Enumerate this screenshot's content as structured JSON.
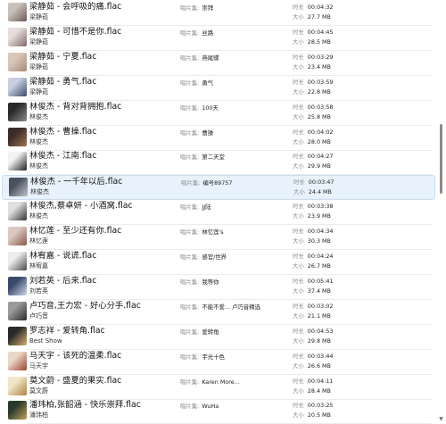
{
  "labels": {
    "album": "唱片集:",
    "duration": "时长",
    "size": "大小"
  },
  "tracks": [
    {
      "title": "梁静茹 - 会呼吸的痛.flac",
      "artist": "梁静茹",
      "album": "崇拜",
      "duration": "00:04:32",
      "size": "27.7 MB",
      "thumb_colors": [
        "#c9c1bb",
        "#6b5a55"
      ]
    },
    {
      "title": "梁静茹 - 可惜不是你.flac",
      "artist": "梁静茹",
      "album": "丝路",
      "duration": "00:04:45",
      "size": "28.5 MB",
      "thumb_colors": [
        "#e7dcdc",
        "#7d6a66"
      ]
    },
    {
      "title": "梁静茹 - 宁夏.flac",
      "artist": "梁静茹",
      "album": "燕尾蝶",
      "duration": "00:03:29",
      "size": "23.4 MB",
      "thumb_colors": [
        "#d8c7b8",
        "#a58b78"
      ]
    },
    {
      "title": "梁静茹 - 勇气.flac",
      "artist": "梁静茹",
      "album": "勇气",
      "duration": "00:03:59",
      "size": "22.8 MB",
      "thumb_colors": [
        "#c7cfe0",
        "#3b4a6b"
      ]
    },
    {
      "title": "林俊杰 - 背对背拥抱.flac",
      "artist": "林俊杰",
      "album": "100天",
      "duration": "00:03:58",
      "size": "25.8 MB",
      "thumb_colors": [
        "#2a2a2a",
        "#8c8c8c"
      ]
    },
    {
      "title": "林俊杰 - 曹操.flac",
      "artist": "林俊杰",
      "album": "曹操",
      "duration": "00:04:02",
      "size": "28.0 MB",
      "thumb_colors": [
        "#3a2c28",
        "#a07050"
      ]
    },
    {
      "title": "林俊杰 - 江南.flac",
      "artist": "林俊杰",
      "album": "第二天堂",
      "duration": "00:04:27",
      "size": "29.9 MB",
      "thumb_colors": [
        "#f2f2f2",
        "#1e1e1e"
      ]
    },
    {
      "title": "林俊杰 - 一千年以后.flac",
      "artist": "林俊杰",
      "album": "编号89757",
      "duration": "00:03:47",
      "size": "24.4 MB",
      "thumb_colors": [
        "#4a5060",
        "#c0c4cc"
      ]
    },
    {
      "title": "林俊杰,蔡卓妍 - 小酒窝.flac",
      "artist": "林俊杰",
      "album": "JJ陆",
      "duration": "00:03:38",
      "size": "23.9 MB",
      "thumb_colors": [
        "#e0e0e0",
        "#333333"
      ]
    },
    {
      "title": "林忆莲 - 至少还有你.flac",
      "artist": "林忆莲",
      "album": "林忆莲's",
      "duration": "00:04:34",
      "size": "30.3 MB",
      "thumb_colors": [
        "#dcc8c0",
        "#8a5a4a"
      ]
    },
    {
      "title": "林宥嘉 - 说谎.flac",
      "artist": "林宥嘉",
      "album": "感官/世界",
      "duration": "00:04:24",
      "size": "26.7 MB",
      "thumb_colors": [
        "#ededed",
        "#4a4a4a"
      ]
    },
    {
      "title": "刘若英 - 后来.flac",
      "artist": "刘若英",
      "album": "我等你",
      "duration": "00:05:41",
      "size": "37.4 MB",
      "thumb_colors": [
        "#3a4a6a",
        "#d0d8e8"
      ]
    },
    {
      "title": "卢巧音,王力宏 - 好心分手.flac",
      "artist": "卢巧音",
      "album": "不能不爱... 卢巧音精选",
      "duration": "00:03:02",
      "size": "21.1 MB",
      "thumb_colors": [
        "#9a9a9a",
        "#2a2a2a"
      ]
    },
    {
      "title": "罗志祥 - 爱转角.flac",
      "artist": "Best Show",
      "album": "爱转角",
      "duration": "00:04:53",
      "size": "29.8 MB",
      "thumb_colors": [
        "#2a2a2a",
        "#d8b070"
      ]
    },
    {
      "title": "马天宇 - 该死的温柔.flac",
      "artist": "马天宇",
      "album": "宇光十色",
      "duration": "00:03:44",
      "size": "26.6 MB",
      "thumb_colors": [
        "#e8d8c8",
        "#a04030"
      ]
    },
    {
      "title": "莫文蔚 - 盛夏的果实.flac",
      "artist": "莫文蔚",
      "album": "Karen More...",
      "duration": "00:04:11",
      "size": "28.4 MB",
      "thumb_colors": [
        "#f0e6c8",
        "#b08040"
      ]
    },
    {
      "title": "潘玮柏,张韶涵 - 快乐崇拜.flac",
      "artist": "潘玮柏",
      "album": "WuHa",
      "duration": "00:03:25",
      "size": "20.5 MB",
      "thumb_colors": [
        "#2a3a2a",
        "#c0a060"
      ]
    }
  ],
  "selected_index": 7,
  "scrollbar": {
    "position_fraction": 0.36
  }
}
